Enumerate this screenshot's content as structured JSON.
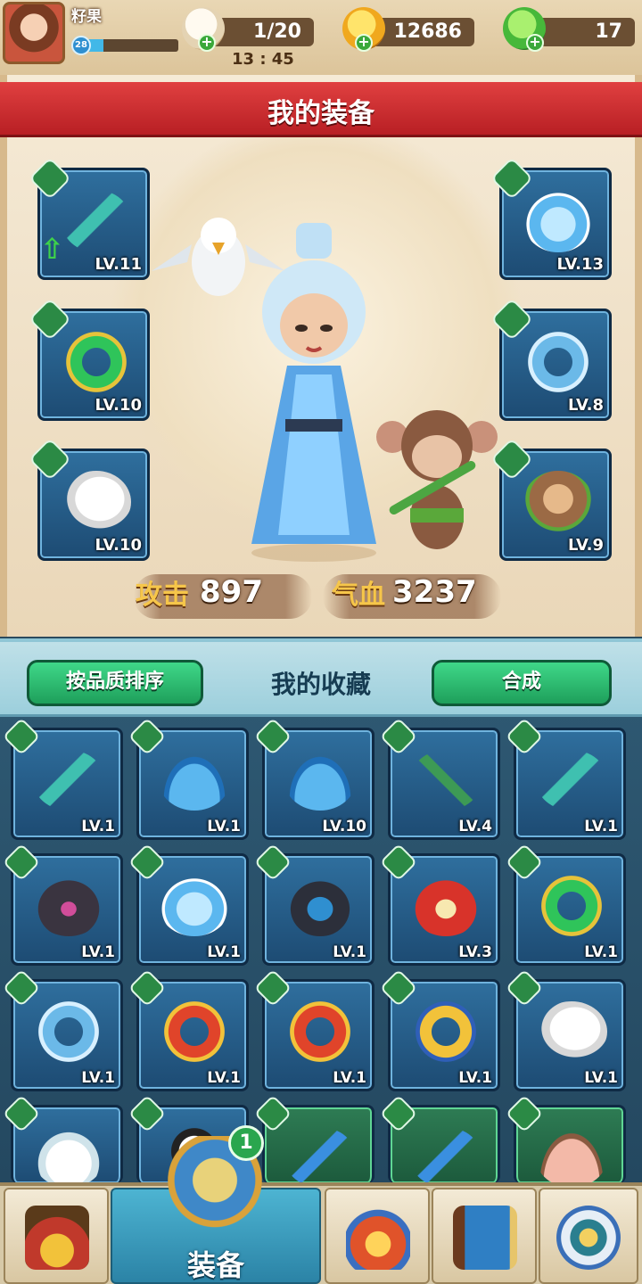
{
  "player": {
    "name": "籽果",
    "level": "28",
    "xp_fraction": 0.18
  },
  "resources": {
    "stamina": "1/20",
    "timer": "13 : 45",
    "gold": "12686",
    "leaf": "17"
  },
  "equipment": {
    "title": "我的装备",
    "left_slots": [
      {
        "lv": "LV.11",
        "type": "weapon",
        "icon": "dagger-icon",
        "upgrade": true
      },
      {
        "lv": "LV.10",
        "type": "accessory",
        "icon": "jade-pendant-icon"
      },
      {
        "lv": "LV.10",
        "type": "pet",
        "icon": "white-owl-icon"
      }
    ],
    "right_slots": [
      {
        "lv": "LV.13",
        "type": "armor",
        "icon": "snow-robe-icon"
      },
      {
        "lv": "LV.8",
        "type": "accessory",
        "icon": "blue-pendant-icon"
      },
      {
        "lv": "LV.9",
        "type": "pet",
        "icon": "monkey-icon"
      }
    ],
    "attack_label": "攻击",
    "attack_value": "897",
    "hp_label": "气血",
    "hp_value": "3237"
  },
  "collection": {
    "sort_button": "按品质排序",
    "title": "我的收藏",
    "merge_button": "合成",
    "items": [
      {
        "lv": "LV.1",
        "icon": "dagger-icon",
        "type": "weapon"
      },
      {
        "lv": "LV.1",
        "icon": "blue-fan-icon",
        "type": "weapon"
      },
      {
        "lv": "LV.10",
        "icon": "blue-fan-icon",
        "type": "weapon"
      },
      {
        "lv": "LV.4",
        "icon": "crossbow-icon",
        "type": "weapon"
      },
      {
        "lv": "LV.1",
        "icon": "dagger-icon",
        "type": "weapon"
      },
      {
        "lv": "LV.1",
        "icon": "dark-robe-icon",
        "type": "armor"
      },
      {
        "lv": "LV.1",
        "icon": "snow-robe-icon",
        "type": "armor"
      },
      {
        "lv": "LV.1",
        "icon": "blue-robe-icon",
        "type": "armor"
      },
      {
        "lv": "LV.3",
        "icon": "red-robe-icon",
        "type": "armor"
      },
      {
        "lv": "LV.1",
        "icon": "jade-pendant-icon",
        "type": "accessory"
      },
      {
        "lv": "LV.1",
        "icon": "blue-pendant-icon",
        "type": "accessory"
      },
      {
        "lv": "LV.1",
        "icon": "red-pendant-icon",
        "type": "accessory"
      },
      {
        "lv": "LV.1",
        "icon": "red-pendant-icon",
        "type": "accessory"
      },
      {
        "lv": "LV.1",
        "icon": "gold-pendant-icon",
        "type": "accessory"
      },
      {
        "lv": "LV.1",
        "icon": "white-owl-icon",
        "type": "pet"
      },
      {
        "lv": "",
        "icon": "ferret-icon",
        "type": "pet"
      },
      {
        "lv": "",
        "icon": "panda-icon",
        "type": "pet"
      },
      {
        "lv": "",
        "icon": "blue-sword-icon",
        "type": "weapon",
        "green": true
      },
      {
        "lv": "",
        "icon": "blue-sword-icon",
        "type": "weapon",
        "green": true
      },
      {
        "lv": "",
        "icon": "pink-fan-icon",
        "type": "weapon",
        "green": true
      }
    ]
  },
  "nav": {
    "active_label": "装备",
    "badge": "1",
    "tabs": [
      {
        "icon": "treasure-shop-icon"
      },
      {
        "icon": "armor-tab-icon"
      },
      {
        "icon": "battle-icon"
      },
      {
        "icon": "book-icon"
      },
      {
        "icon": "settings-gear-icon"
      }
    ]
  },
  "colors": {
    "slot_blue": "#1d4b73",
    "slot_green": "#1c5a3c",
    "title_red": "#c8262b",
    "button_green": "#27b56a"
  }
}
